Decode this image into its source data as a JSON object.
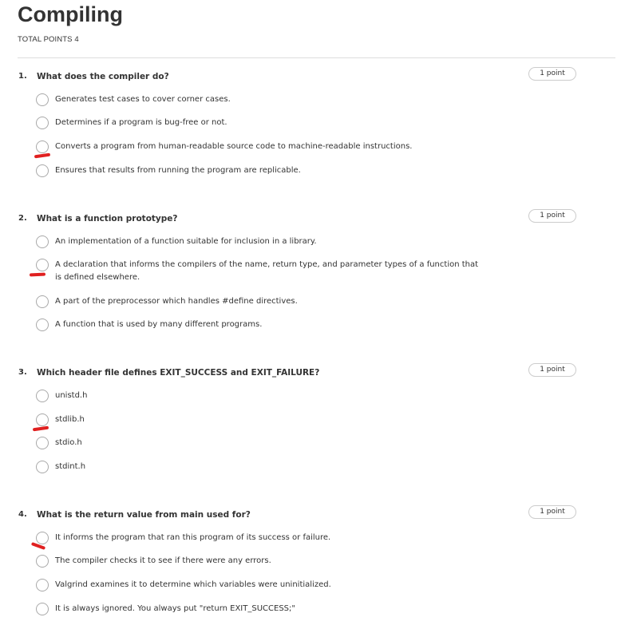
{
  "page": {
    "title": "Compiling",
    "total_points": "TOTAL POINTS 4"
  },
  "questions": [
    {
      "number": "1.",
      "text": "What does the compiler do?",
      "points": "1 point",
      "options": [
        "Generates test cases to cover corner cases.",
        "Determines if a program is bug-free or not.",
        "Converts a program from human-readable source code to machine-readable instructions.",
        "Ensures that results from running the program are replicable."
      ],
      "marked_option": 2
    },
    {
      "number": "2.",
      "text": "What is a function prototype?",
      "points": "1 point",
      "options": [
        "An implementation of a function suitable for inclusion in a library.",
        "A declaration that informs the compilers of the name, return type, and parameter types of a function that is defined elsewhere.",
        "A part of the preprocessor which handles #define directives.",
        "A function that is used by many different programs."
      ],
      "marked_option": 1
    },
    {
      "number": "3.",
      "text": "Which header file defines EXIT_SUCCESS and EXIT_FAILURE?",
      "points": "1 point",
      "options": [
        "unistd.h",
        "stdlib.h",
        "stdio.h",
        "stdint.h"
      ],
      "marked_option": 1
    },
    {
      "number": "4.",
      "text": "What is the return value from main used for?",
      "points": "1 point",
      "options": [
        "It informs the program that ran this program of its success or failure.",
        "The compiler checks it to see if there were any errors.",
        "Valgrind examines it to determine which variables were uninitialized.",
        "It is always ignored. You always put \"return EXIT_SUCCESS;\""
      ],
      "marked_option": 0
    }
  ],
  "colors": {
    "annotation_mark": "#e02020",
    "radio_border": "#a9a9a9",
    "divider": "#dddddd"
  }
}
